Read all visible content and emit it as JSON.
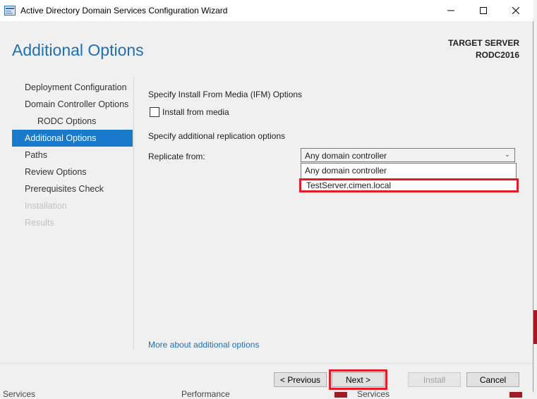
{
  "window": {
    "title": "Active Directory Domain Services Configuration Wizard"
  },
  "header": {
    "heading": "Additional Options",
    "target_label": "TARGET SERVER",
    "target_name": "RODC2016"
  },
  "nav": {
    "items": [
      {
        "label": "Deployment Configuration",
        "state": "normal"
      },
      {
        "label": "Domain Controller Options",
        "state": "normal"
      },
      {
        "label": "RODC Options",
        "state": "sub"
      },
      {
        "label": "Additional Options",
        "state": "active"
      },
      {
        "label": "Paths",
        "state": "normal"
      },
      {
        "label": "Review Options",
        "state": "normal"
      },
      {
        "label": "Prerequisites Check",
        "state": "normal"
      },
      {
        "label": "Installation",
        "state": "disabled"
      },
      {
        "label": "Results",
        "state": "disabled"
      }
    ]
  },
  "main": {
    "ifm_heading": "Specify Install From Media (IFM) Options",
    "install_from_media_label": "Install from media",
    "replication_heading": "Specify additional replication options",
    "replicate_from_label": "Replicate from:",
    "replicate_from_value": "Any domain controller",
    "replicate_options": [
      "Any domain controller",
      "TestServer.cimen.local"
    ],
    "more_link": "More about additional options"
  },
  "footer": {
    "previous": "< Previous",
    "next": "Next >",
    "install": "Install",
    "cancel": "Cancel"
  },
  "background": {
    "labels": [
      "Services",
      "Performance",
      "Services"
    ]
  },
  "colors": {
    "accent": "#1979ca",
    "heading": "#1f6fb5",
    "highlight_box": "#e41c2a"
  }
}
